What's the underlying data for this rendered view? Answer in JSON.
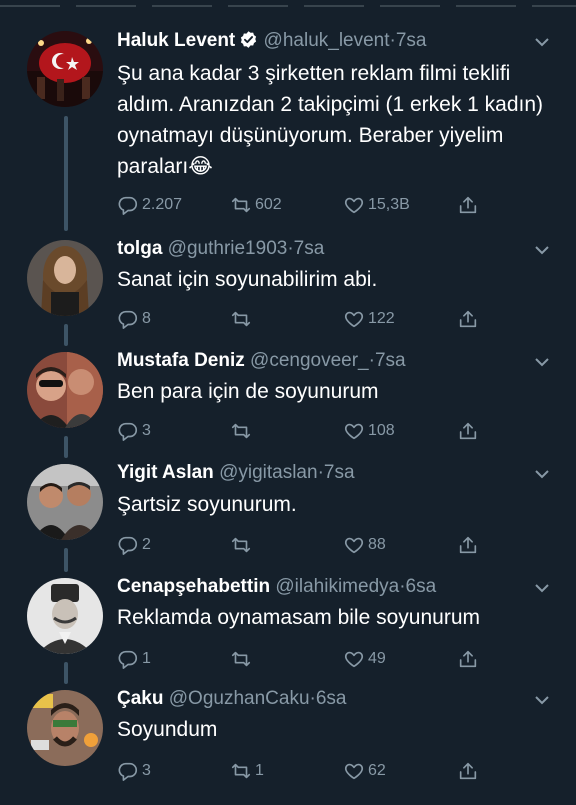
{
  "tweets": [
    {
      "name": "Haluk Levent",
      "verified": true,
      "handle": "@haluk_levent",
      "time": "7sa",
      "text": "Şu ana kadar 3 şirketten reklam filmi teklifi aldım. Aranızdan 2 takipçimi (1 erkek 1 kadın) oynatmayı düşünüyorum. Beraber yiyelim paraları😂",
      "replies": "2.207",
      "retweets": "602",
      "likes": "15,3B"
    },
    {
      "name": "tolga",
      "handle": "@guthrie1903",
      "time": "7sa",
      "text": "Sanat için soyunabilirim abi.",
      "replies": "8",
      "retweets": "",
      "likes": "122"
    },
    {
      "name": "Mustafa Deniz",
      "handle": "@cengoveer_",
      "time": "7sa",
      "text": "Ben para için de soyunurum",
      "replies": "3",
      "retweets": "",
      "likes": "108"
    },
    {
      "name": "Yigit Aslan",
      "handle": "@yigitaslan",
      "time": "7sa",
      "text": "Şartsiz soyunurum.",
      "replies": "2",
      "retweets": "",
      "likes": "88"
    },
    {
      "name": "Cenapşehabettin",
      "handle": "@ilahikimedya",
      "time": "6sa",
      "text": "Reklamda oynamasam bile soyunurum",
      "replies": "1",
      "retweets": "",
      "likes": "49"
    },
    {
      "name": "Çaku",
      "handle": "@OguzhanCaku",
      "time": "6sa",
      "text": "Soyundum",
      "replies": "3",
      "retweets": "1",
      "likes": "62"
    }
  ],
  "colors": {
    "background": "#15202b",
    "secondary_text": "#8899a6",
    "thread_line": "#3d5466",
    "verified_badge": "#ffffff"
  }
}
